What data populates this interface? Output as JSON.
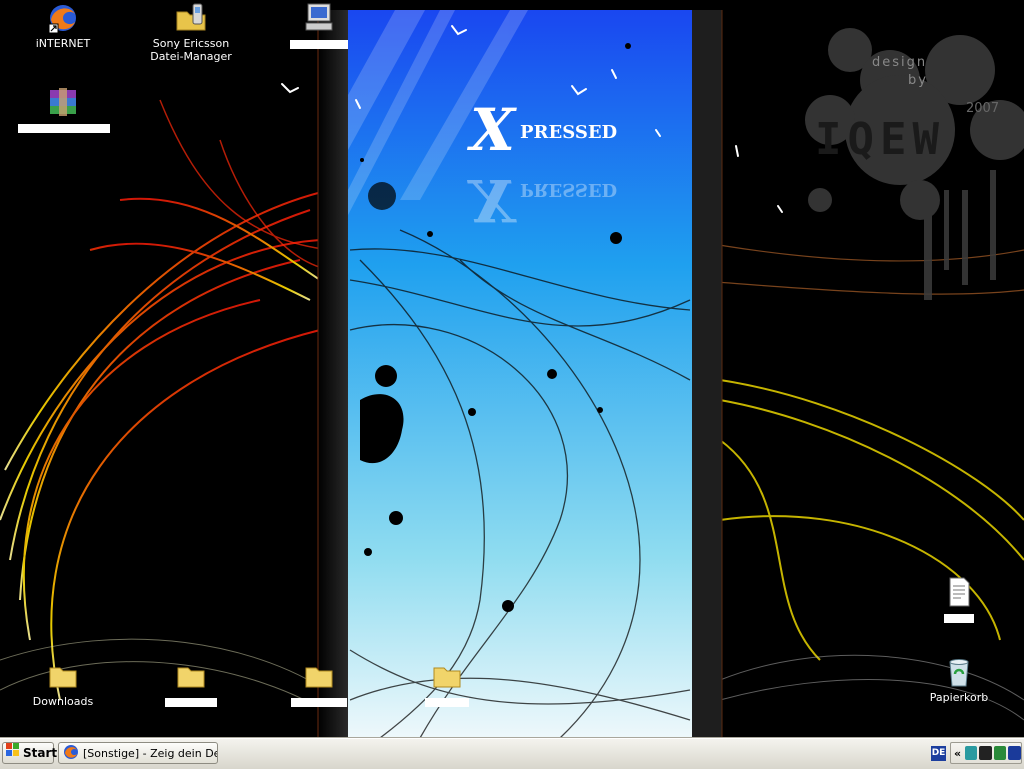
{
  "wallpaper": {
    "title_big_letter": "X",
    "title_rest": "PRESSED",
    "credit_line1": "design",
    "credit_line2": "by",
    "credit_year": "2007",
    "credit_name": "IQEW"
  },
  "desktop_icons": [
    {
      "name": "internet",
      "label": "iNTERNET",
      "icon": "firefox-icon"
    },
    {
      "name": "sony-ericsson",
      "label": "Sony Ericsson\nDatei-Manager",
      "icon": "folder-phone-icon"
    },
    {
      "name": "computer",
      "label": "",
      "icon": "computer-icon"
    },
    {
      "name": "winrar",
      "label": "",
      "icon": "winrar-icon"
    },
    {
      "name": "downloads",
      "label": "Downloads",
      "icon": "folder-icon"
    },
    {
      "name": "folder-2",
      "label": "",
      "icon": "folder-icon"
    },
    {
      "name": "folder-3",
      "label": "",
      "icon": "folder-icon"
    },
    {
      "name": "folder-4",
      "label": "",
      "icon": "folder-icon"
    },
    {
      "name": "document",
      "label": "",
      "icon": "document-icon"
    },
    {
      "name": "recycle-bin",
      "label": "Papierkorb",
      "icon": "recycle-bin-icon"
    }
  ],
  "taskbar": {
    "start_label": "Start",
    "task_label": "[Sonstige] - Zeig dein De...",
    "language": "DE",
    "tray_chevron": "«"
  },
  "colors": {
    "taskbar": "#ece9d8",
    "panel_top": "#1b4cf0",
    "panel_bottom": "#e8f6fb"
  }
}
